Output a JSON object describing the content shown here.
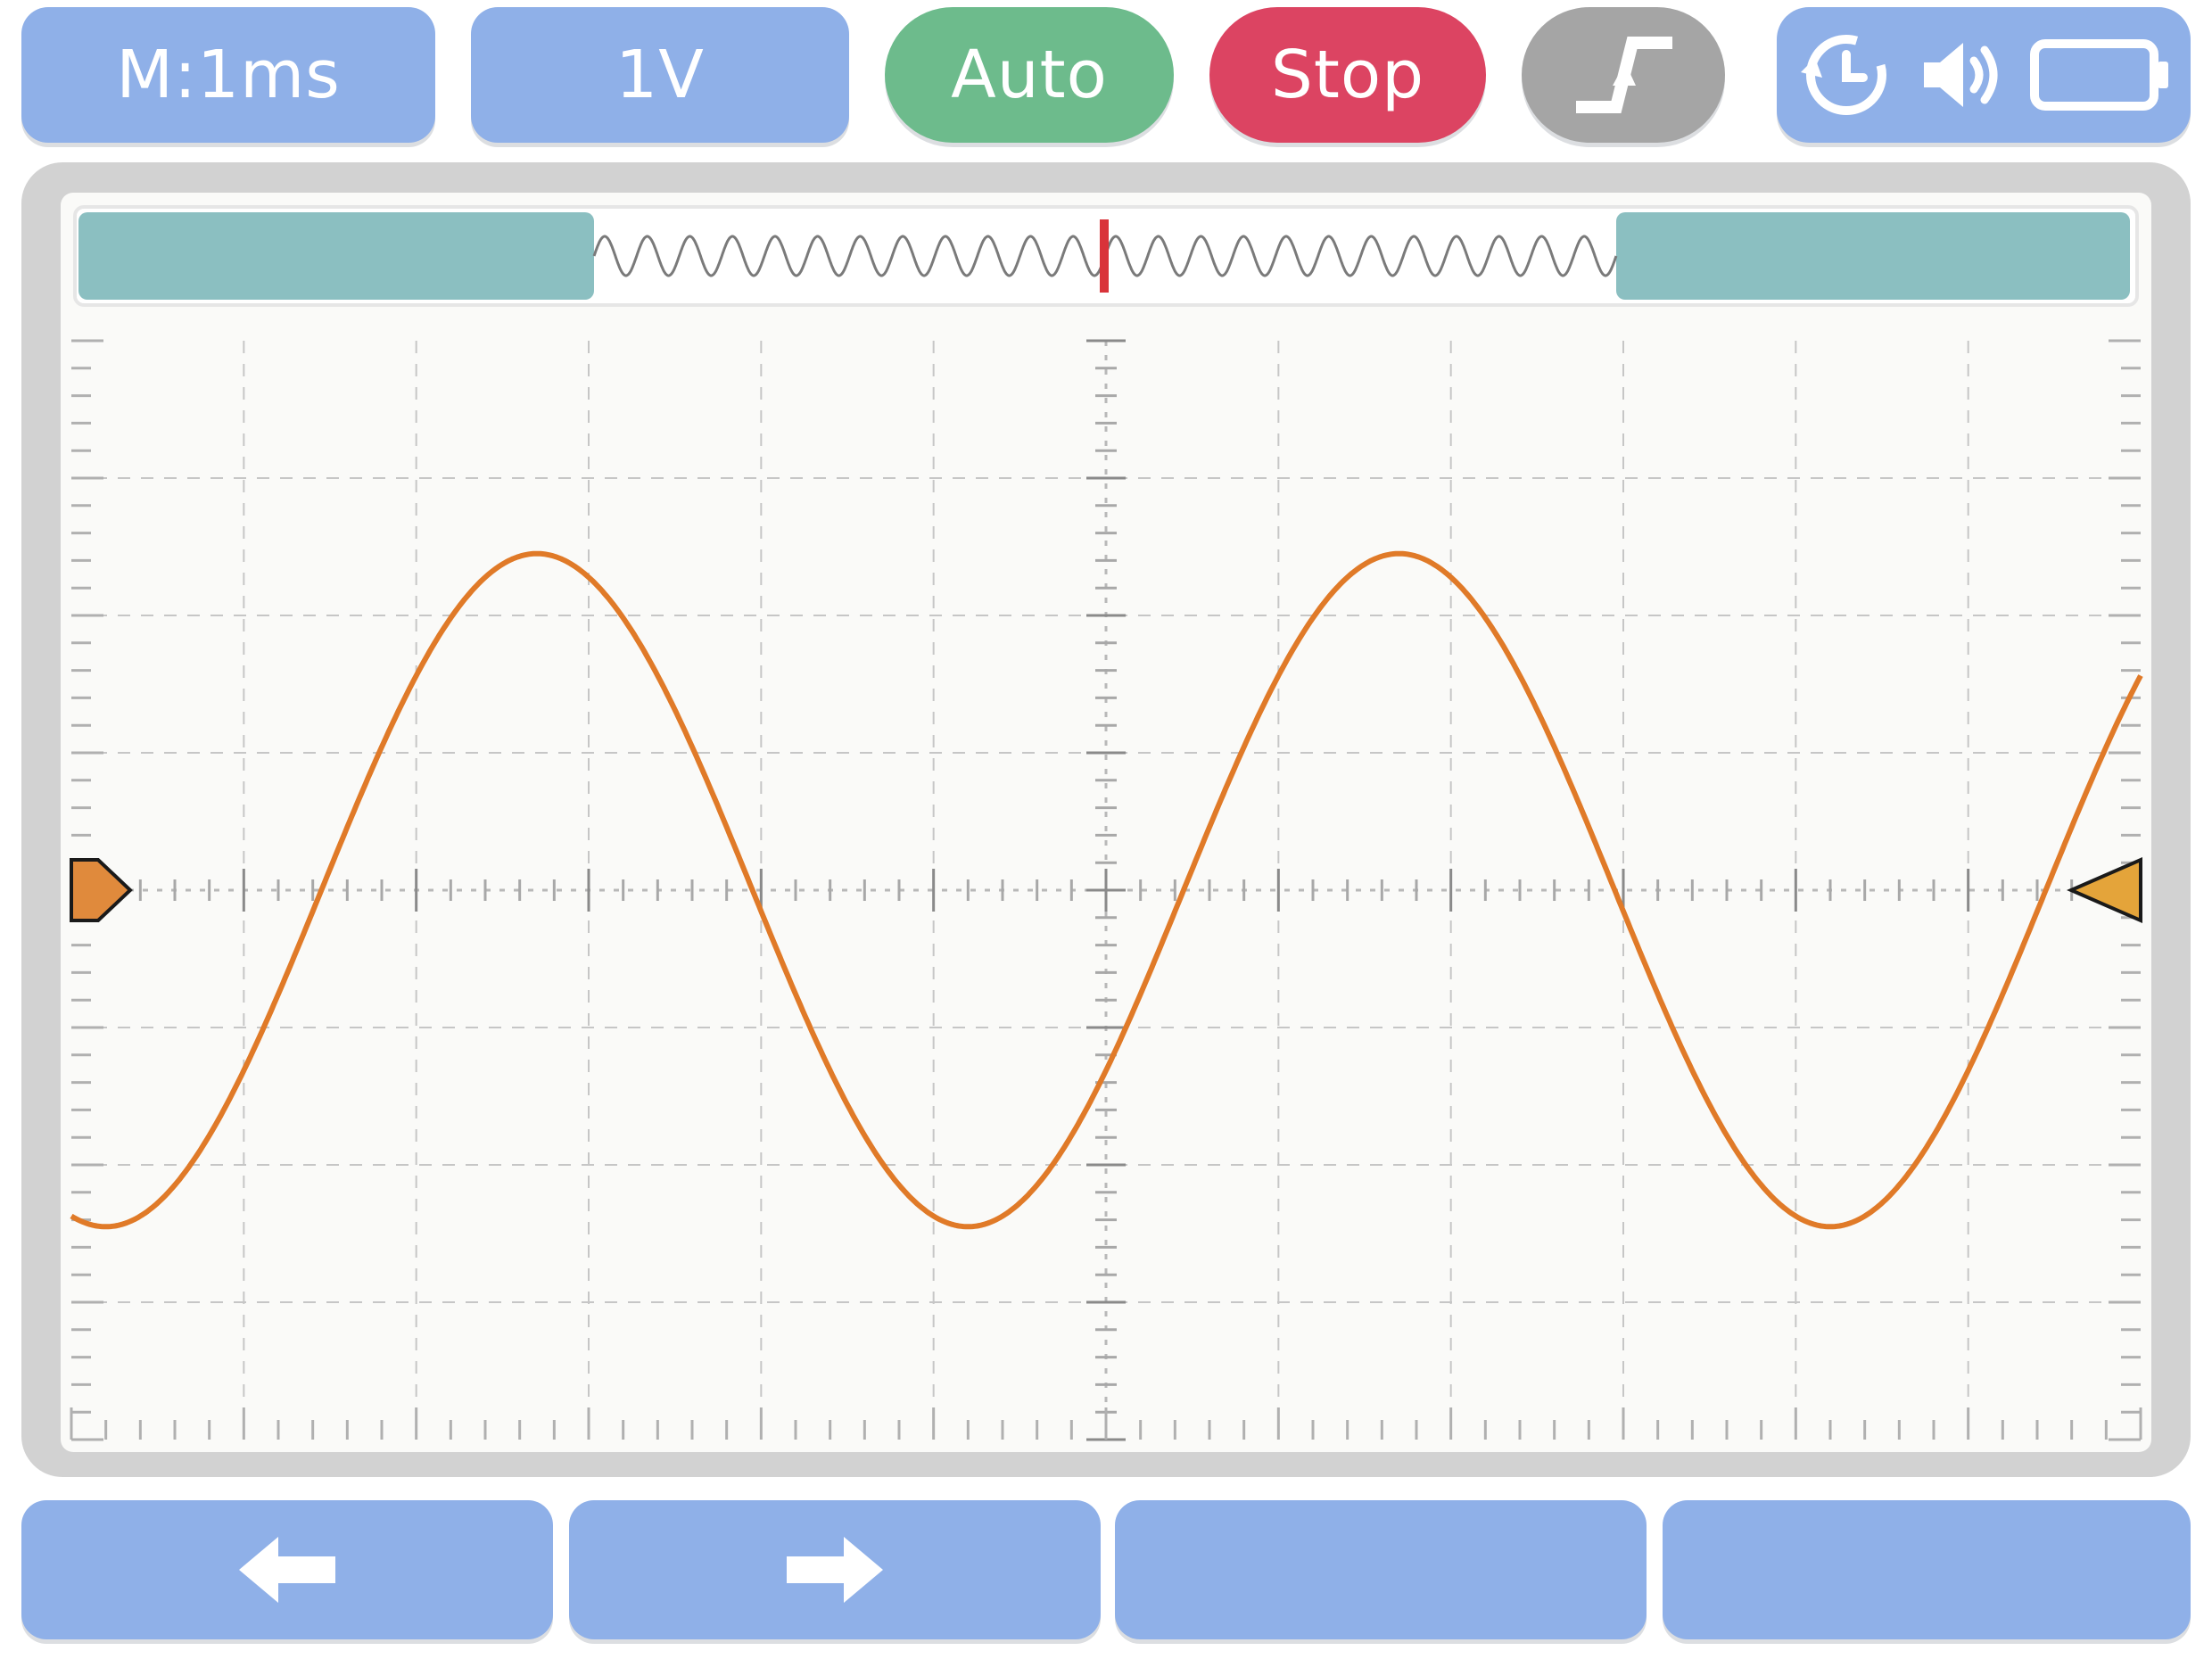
{
  "toolbar": {
    "timebase_label": "M:1ms",
    "volts_label": "1V",
    "mode_label": "Auto",
    "run_label": "Stop",
    "trigger_edge_icon": "rising-edge-icon",
    "status_icons": [
      "history-clock-icon",
      "speaker-icon",
      "battery-icon"
    ]
  },
  "waveform": {
    "trace_color": "#e07a28",
    "cycles_in_view": 2.4,
    "amplitude_divisions": 2.45
  },
  "markers": {
    "left_color": "#e08a3c",
    "right_color": "#e4a43a"
  },
  "softkeys": [
    {
      "icon": "arrow-left-icon"
    },
    {
      "icon": "arrow-right-icon"
    },
    {
      "icon": ""
    },
    {
      "icon": ""
    }
  ],
  "colors": {
    "button_blue": "#8fb0e8",
    "auto_green": "#6dbb8c",
    "stop_red": "#dc4462",
    "trigger_gray": "#a5a5a5",
    "nav_window": "#8bbfc1",
    "trigger_marker": "#d9333a"
  }
}
